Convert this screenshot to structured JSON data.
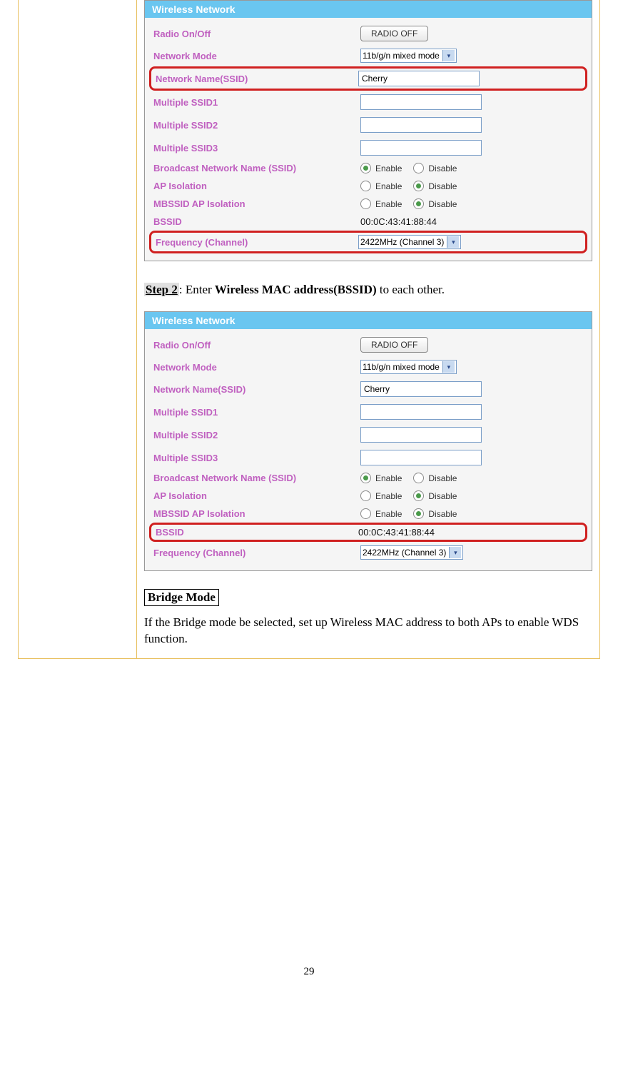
{
  "panel1": {
    "header": "Wireless Network",
    "radio_label": "Radio On/Off",
    "radio_button": "RADIO OFF",
    "netmode_label": "Network Mode",
    "netmode_value": "11b/g/n mixed mode",
    "ssid_label": "Network Name(SSID)",
    "ssid_value": "Cherry",
    "mssid1_label": "Multiple SSID1",
    "mssid1_value": "",
    "mssid2_label": "Multiple SSID2",
    "mssid2_value": "",
    "mssid3_label": "Multiple SSID3",
    "mssid3_value": "",
    "broadcast_label": "Broadcast Network Name (SSID)",
    "apiso_label": "AP Isolation",
    "mbssid_label": "MBSSID AP Isolation",
    "bssid_label": "BSSID",
    "bssid_value": "00:0C:43:41:88:44",
    "freq_label": "Frequency (Channel)",
    "freq_value": "2422MHz (Channel 3)",
    "enable": "Enable",
    "disable": "Disable"
  },
  "step2": {
    "label": "Step 2",
    "sep": ": Enter ",
    "bold": "Wireless MAC address(BSSID)",
    "rest": " to each other."
  },
  "panel2": {
    "header": "Wireless Network",
    "radio_label": "Radio On/Off",
    "radio_button": "RADIO OFF",
    "netmode_label": "Network Mode",
    "netmode_value": "11b/g/n mixed mode",
    "ssid_label": "Network Name(SSID)",
    "ssid_value": "Cherry",
    "mssid1_label": "Multiple SSID1",
    "mssid1_value": "",
    "mssid2_label": "Multiple SSID2",
    "mssid2_value": "",
    "mssid3_label": "Multiple SSID3",
    "mssid3_value": "",
    "broadcast_label": "Broadcast Network Name (SSID)",
    "apiso_label": "AP Isolation",
    "mbssid_label": "MBSSID AP Isolation",
    "bssid_label": "BSSID",
    "bssid_value": "00:0C:43:41:88:44",
    "freq_label": "Frequency (Channel)",
    "freq_value": "2422MHz (Channel 3)",
    "enable": "Enable",
    "disable": "Disable"
  },
  "bridge": {
    "heading": "Bridge Mode",
    "text": "If the Bridge mode be selected, set up Wireless MAC address to both APs to enable WDS function."
  },
  "page_number": "29"
}
